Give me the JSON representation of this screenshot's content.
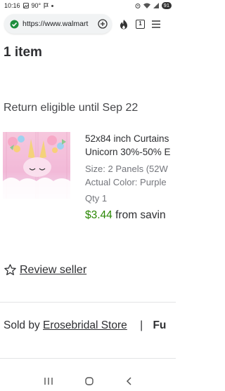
{
  "status": {
    "time": "10:16",
    "temp": "90°",
    "battery": "91"
  },
  "browser": {
    "url": "https://www.walmart",
    "tab_count": "1"
  },
  "cart": {
    "item_count": "1 item",
    "return_text": "Return eligible until Sep 22"
  },
  "product": {
    "title_line1": "52x84 inch Curtains",
    "title_line2": "Unicorn 30%-50% E",
    "size": "Size: 2 Panels (52W",
    "color": "Actual Color: Purple",
    "qty": "Qty 1",
    "price": "$3.44",
    "price_suffix": "from savin"
  },
  "review": {
    "label": "Review seller"
  },
  "seller": {
    "sold_by": "Sold by",
    "name": "Erosebridal Store",
    "separator": "|",
    "trailing": "Fu"
  }
}
